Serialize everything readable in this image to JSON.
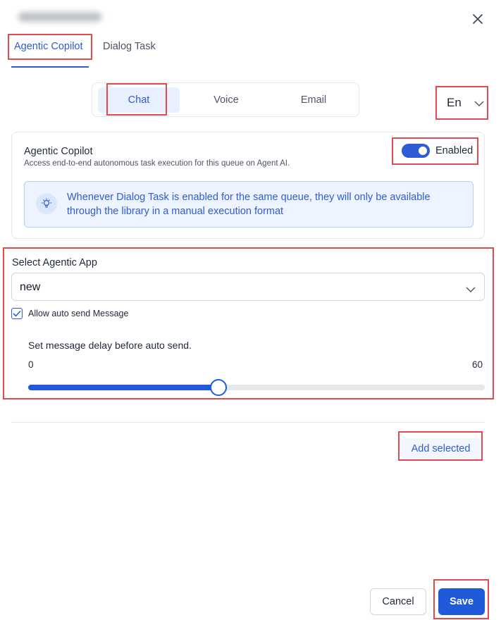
{
  "tabs": [
    {
      "label": "Agentic Copilot",
      "active": true
    },
    {
      "label": "Dialog Task",
      "active": false
    }
  ],
  "channels": [
    {
      "label": "Chat",
      "active": true
    },
    {
      "label": "Voice",
      "active": false
    },
    {
      "label": "Email",
      "active": false
    }
  ],
  "language": {
    "value": "En"
  },
  "copilot_card": {
    "title": "Agentic Copilot",
    "description": "Access end-to-end autonomous task execution for this queue on Agent AI.",
    "toggle_label": "Enabled",
    "toggle_on": true,
    "info_text": "Whenever Dialog Task is enabled for the same queue, they will only be available through the library in a manual execution format"
  },
  "agentic_app": {
    "label": "Select Agentic App",
    "value": "new"
  },
  "auto_send": {
    "label": "Allow auto send Message",
    "checked": true
  },
  "delay": {
    "label": "Set message delay before auto send.",
    "min_label": "0",
    "max_label": "60",
    "min": 0,
    "max": 60,
    "value": 25
  },
  "actions": {
    "add_selected": "Add selected",
    "cancel": "Cancel",
    "save": "Save"
  },
  "colors": {
    "accent": "#2e5bd6",
    "highlight": "#e5484d"
  }
}
